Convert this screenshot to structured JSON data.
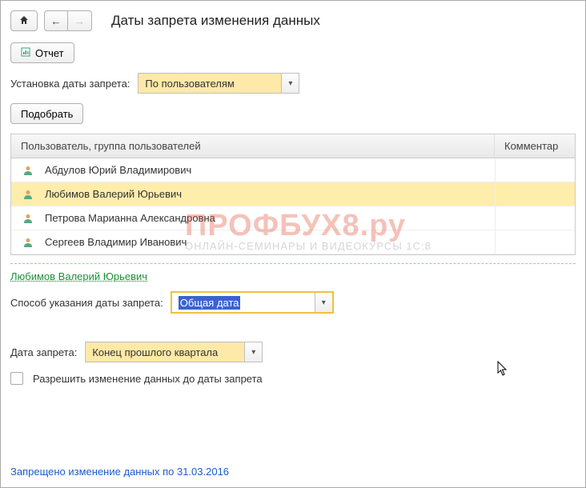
{
  "header": {
    "title": "Даты запрета изменения данных"
  },
  "buttons": {
    "report": "Отчет",
    "select": "Подобрать"
  },
  "settings": {
    "install_label": "Установка даты запрета:",
    "install_value": "По пользователям",
    "method_label": "Способ указания даты запрета:",
    "method_value": "Общая дата",
    "date_label": "Дата запрета:",
    "date_value": "Конец прошлого квартала",
    "allow_edit_label": "Разрешить изменение данных до даты запрета"
  },
  "table": {
    "columns": {
      "user": "Пользователь, группа пользователей",
      "comment": "Комментар"
    },
    "rows": [
      {
        "name": "Абдулов Юрий Владимирович",
        "selected": false
      },
      {
        "name": "Любимов Валерий Юрьевич",
        "selected": true
      },
      {
        "name": "Петрова Марианна Александровна",
        "selected": false
      },
      {
        "name": "Сергеев Владимир Иванович",
        "selected": false
      }
    ]
  },
  "section": {
    "title": "Любимов Валерий Юрьевич"
  },
  "footer": {
    "status": "Запрещено изменение данных по 31.03.2016"
  },
  "watermark": {
    "main": "ПРОФБУХ8.ру",
    "sub": "ОНЛАЙН-СЕМИНАРЫ И ВИДЕОКУРСЫ 1С:8"
  }
}
